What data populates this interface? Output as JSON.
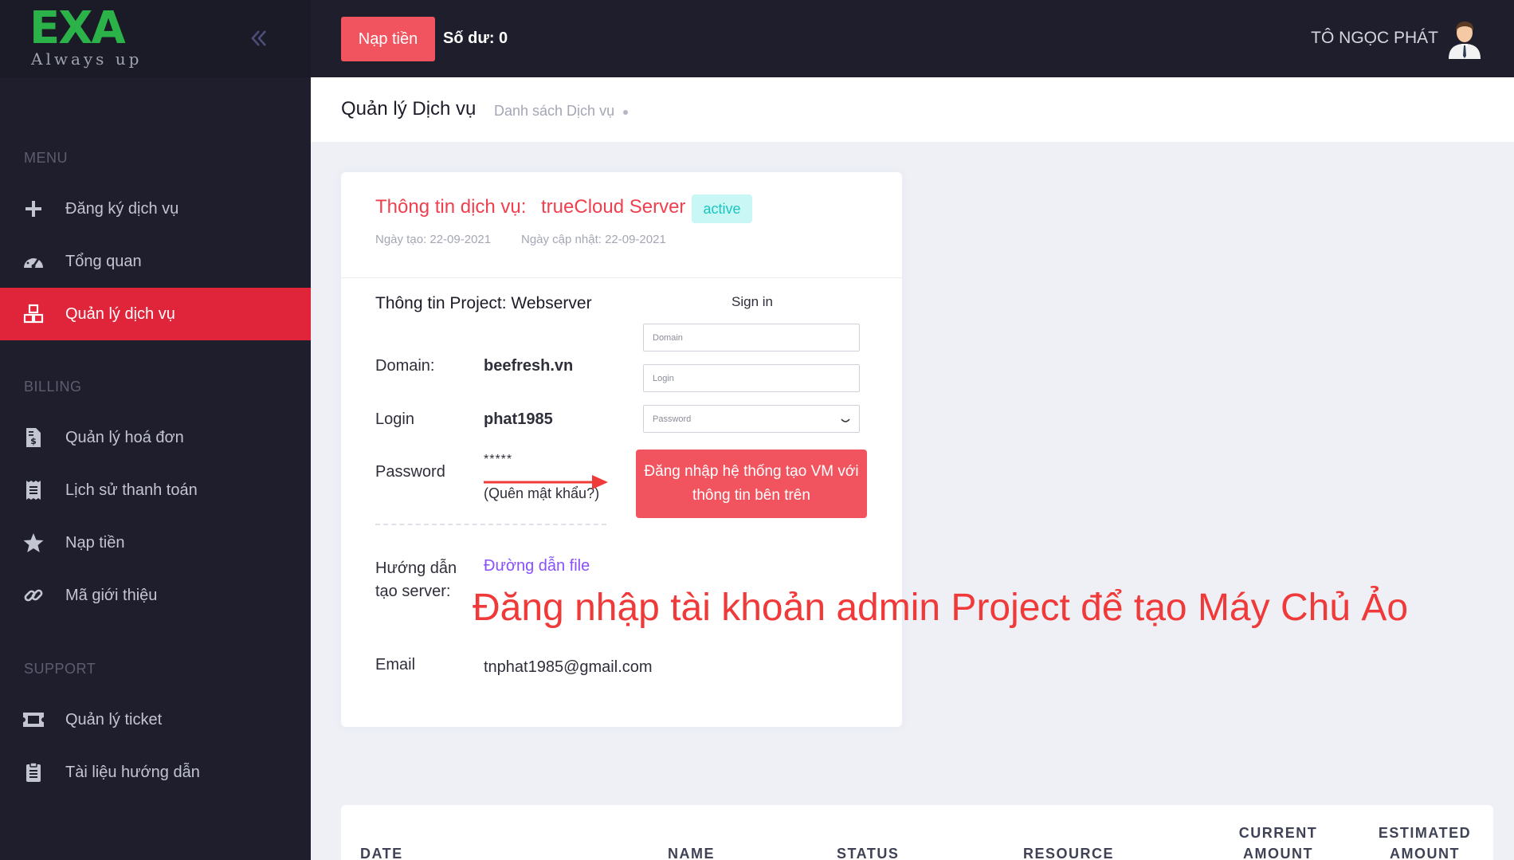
{
  "sidebar": {
    "logo_text": "EXA",
    "logo_tagline": "Always up",
    "sections": {
      "menu": "MENU",
      "billing": "BILLING",
      "support": "SUPPORT"
    },
    "items": [
      {
        "label": "Đăng ký dịch vụ",
        "icon": "plus-icon"
      },
      {
        "label": "Tổng quan",
        "icon": "speedometer-icon"
      },
      {
        "label": "Quản lý dịch vụ",
        "icon": "cubes-icon",
        "active": true
      },
      {
        "label": "Quản lý hoá đơn",
        "icon": "invoice-icon"
      },
      {
        "label": "Lịch sử thanh toán",
        "icon": "receipt-icon"
      },
      {
        "label": "Nạp tiền",
        "icon": "star-icon"
      },
      {
        "label": "Mã giới thiệu",
        "icon": "link-icon"
      },
      {
        "label": "Quản lý ticket",
        "icon": "ticket-icon"
      },
      {
        "label": "Tài liệu hướng dẫn",
        "icon": "clipboard-icon"
      }
    ],
    "accent_color": "#e0253a"
  },
  "header": {
    "deposit_button": "Nạp tiền",
    "balance": "Số dư: 0",
    "username": "TÔ NGỌC PHÁT"
  },
  "subheader": {
    "title": "Quản lý Dịch vụ",
    "breadcrumb": "Danh sách Dịch vụ"
  },
  "service": {
    "title_prefix": "Thông tin dịch vụ:",
    "name": "trueCloud Server",
    "status": "active",
    "created": "Ngày tạo: 22-09-2021",
    "updated": "Ngày cập nhật: 22-09-2021",
    "project_title": "Thông tin Project: Webserver",
    "domain_label": "Domain:",
    "domain_value": "beefresh.vn",
    "login_label": "Login",
    "login_value": "phat1985",
    "password_label": "Password",
    "password_value": "*****",
    "forgot_password": "(Quên mật khẩu?)",
    "guide_label": "Hướng dẫn tạo server:",
    "guide_link": "Đường dẫn file",
    "email_label": "Email",
    "email_value": "tnphat1985@gmail.com"
  },
  "signin": {
    "title": "Sign in",
    "domain_placeholder": "Domain",
    "login_placeholder": "Login",
    "password_placeholder": "Password",
    "button": "Đăng nhập hệ thống tạo VM với thông tin bên trên"
  },
  "annotation": {
    "text": "Đăng nhập tài khoản admin Project để tạo Máy Chủ Ảo",
    "color": "#f03a3a"
  },
  "table": {
    "columns": [
      "DATE",
      "NAME",
      "STATUS",
      "RESOURCE",
      "CURRENT AMOUNT",
      "ESTIMATED AMOUNT"
    ]
  }
}
